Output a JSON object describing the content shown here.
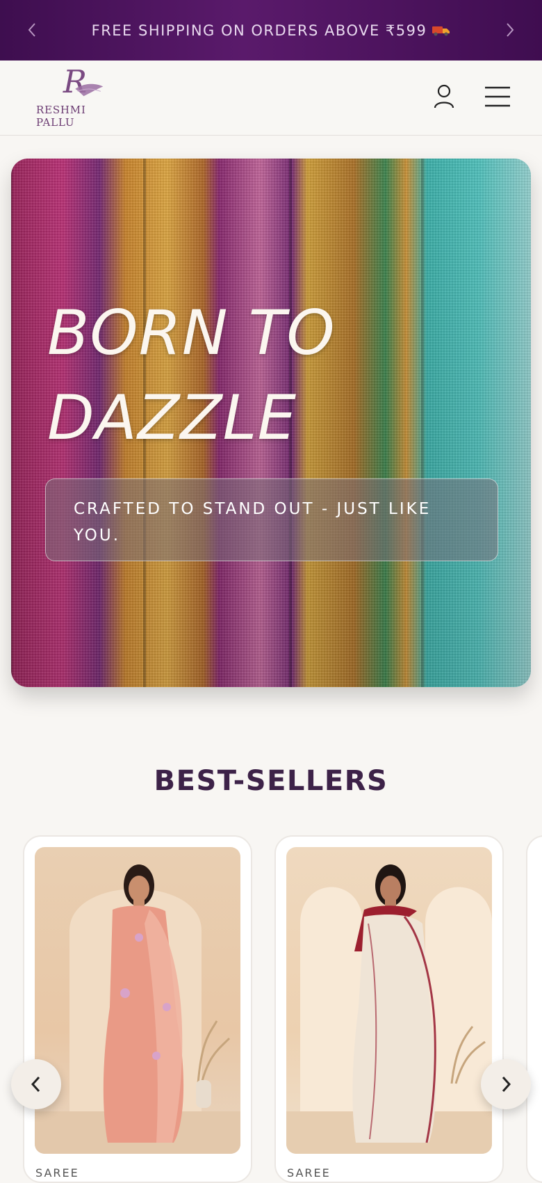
{
  "announcement": {
    "message": "FREE SHIPPING ON ORDERS ABOVE ₹599",
    "truck_icon": "truck-icon",
    "prev_icon": "chevron-left-icon",
    "next_icon": "chevron-right-icon"
  },
  "header": {
    "brand_mark": "R",
    "brand_name": "RESHMI PALLU",
    "account_icon": "user-icon",
    "menu_icon": "hamburger-menu-icon"
  },
  "hero": {
    "title_line1": "BORN TO",
    "title_line2": "DAZZLE",
    "subtitle": "CRAFTED TO STAND OUT - JUST LIKE YOU."
  },
  "best_sellers": {
    "title": "BEST-SELLERS",
    "products": [
      {
        "category": "SAREE"
      },
      {
        "category": "SAREE"
      }
    ],
    "prev_icon": "chevron-left-icon",
    "next_icon": "chevron-right-icon"
  },
  "colors": {
    "announcement_bg": "#4e1560",
    "brand_purple": "#6b3b72",
    "heading": "#3d2248"
  }
}
